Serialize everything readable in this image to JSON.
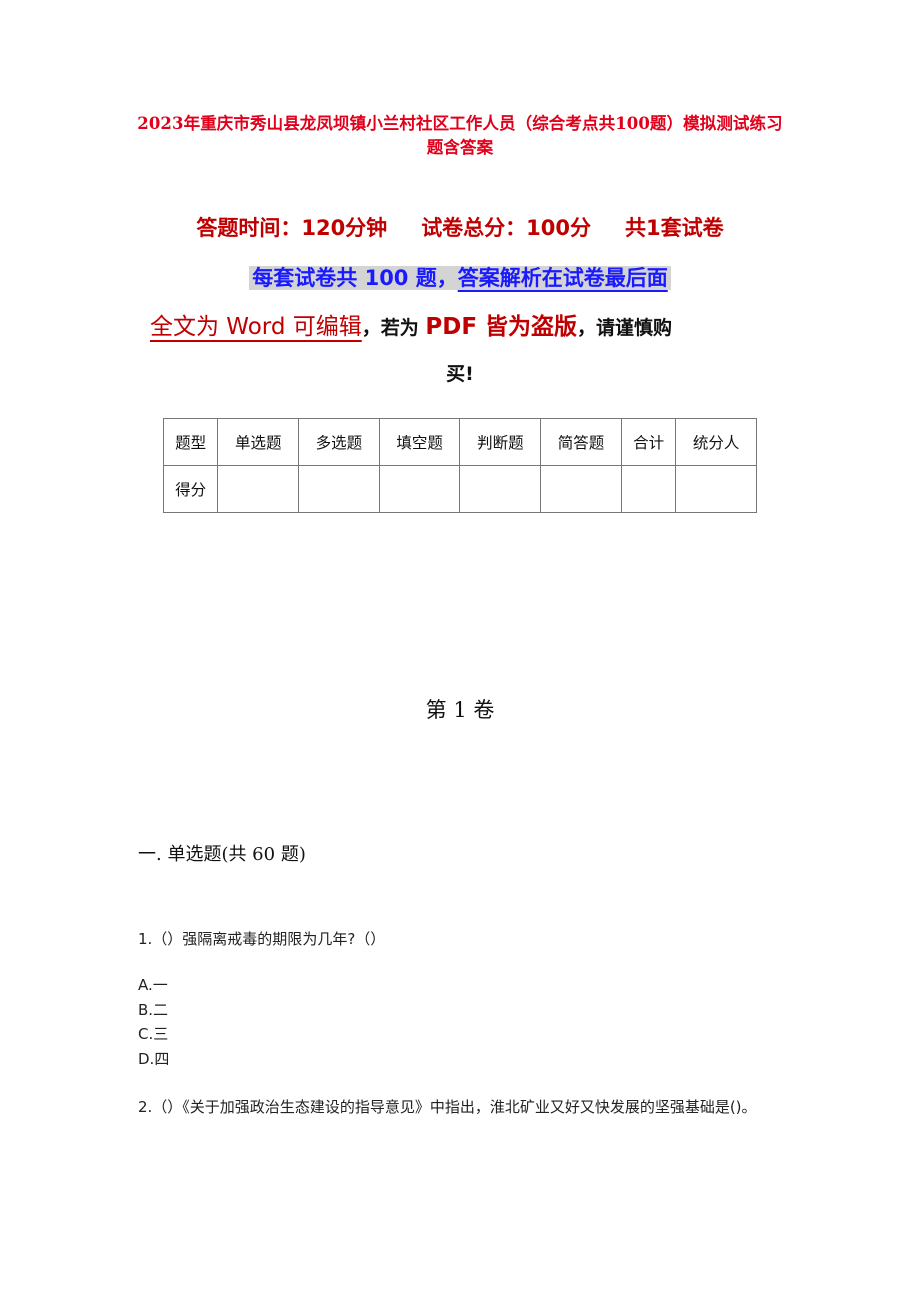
{
  "document": {
    "title": "2023年重庆市秀山县龙凤坝镇小兰村社区工作人员（综合考点共100题）模拟测试练习题含答案",
    "meta": {
      "time_label": "答题时间：120分钟",
      "score_label": "试卷总分：100分",
      "sets_label": "共1套试卷"
    },
    "notice": {
      "part1": "每套试卷共 100 题，",
      "part2": "答案解析在试卷最后面"
    },
    "warning": {
      "part1": "全文为 Word 可编辑",
      "part2": "，若为 ",
      "part3": "PDF 皆为盗版",
      "part4": "，请谨慎购",
      "part5": "买!"
    },
    "score_table": {
      "header": [
        "题型",
        "单选题",
        "多选题",
        "填空题",
        "判断题",
        "简答题",
        "合计",
        "统分人"
      ],
      "row": [
        "得分",
        "",
        "",
        "",
        "",
        "",
        "",
        ""
      ]
    },
    "volume_title": "第 1 卷",
    "section_title": "一. 单选题(共 60 题)",
    "questions": [
      {
        "text": "1.（）强隔离戒毒的期限为几年?（）",
        "options": [
          "A.一",
          "B.二",
          "C.三",
          "D.四"
        ]
      },
      {
        "text": "2.（）《关于加强政治生态建设的指导意见》中指出，淮北矿业又好又快发展的坚强基础是()。"
      }
    ]
  },
  "colors": {
    "title_red": "#e0001b",
    "meta_red": "#c00000",
    "notice_blue": "#1a1aff",
    "notice_highlight": "#d4d4d4"
  }
}
